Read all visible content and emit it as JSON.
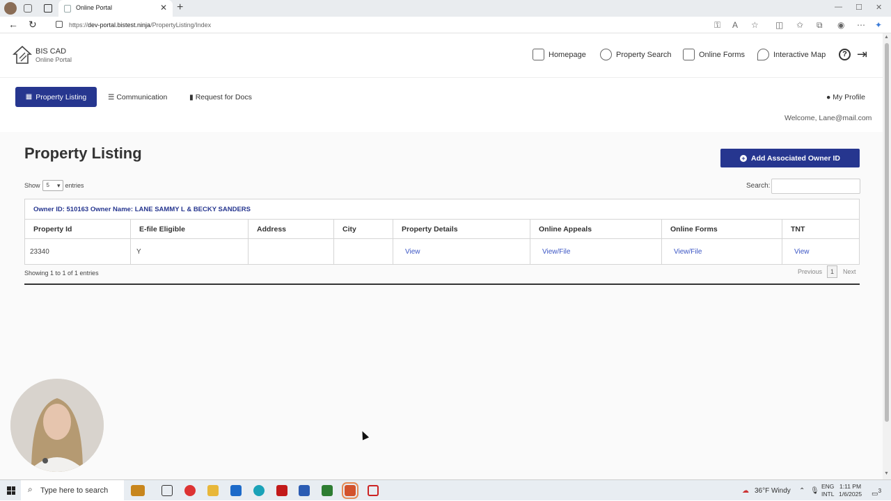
{
  "browser": {
    "tab_title": "Online Portal",
    "url_prefix": "https://",
    "url_domain": "dev-portal.bistest.ninja",
    "url_path": "/PropertyListing/Index"
  },
  "portal": {
    "logo_title": "BIS CAD",
    "logo_subtitle": "Online Portal",
    "top_nav": [
      {
        "label": "Homepage"
      },
      {
        "label": "Property Search"
      },
      {
        "label": "Online Forms"
      },
      {
        "label": "Interactive Map"
      }
    ],
    "sub_nav": {
      "active": "Property Listing",
      "communication": "Communication",
      "request_docs": "Request for Docs",
      "profile": "My Profile",
      "welcome": "Welcome, Lane@mail.com"
    }
  },
  "listing": {
    "title": "Property Listing",
    "add_button": "Add Associated Owner ID",
    "show_label": "Show",
    "entries_value": "5",
    "entries_label": "entries",
    "search_label": "Search:",
    "owner_line": "Owner ID: 510163 Owner Name: LANE SAMMY L & BECKY SANDERS",
    "columns": [
      "Property Id",
      "E-file Eligible",
      "Address",
      "City",
      "Property Details",
      "Online Appeals",
      "Online Forms",
      "TNT"
    ],
    "rows": [
      {
        "property_id": "23340",
        "efile": "Y",
        "address": "",
        "city": "",
        "details": "View",
        "appeals": "View/File",
        "forms": "View/File",
        "tnt": "View"
      }
    ],
    "showing": "Showing 1 to 1 of 1 entries",
    "prev": "Previous",
    "page": "1",
    "next": "Next"
  },
  "taskbar": {
    "search_placeholder": "Type here to search",
    "weather": "36°F  Windy",
    "lang1": "ENG",
    "lang2": "INTL",
    "time": "1:11 PM",
    "date": "1/6/2025",
    "notifications": "3"
  },
  "colors": {
    "primary": "#26368f",
    "link": "#3b55c4"
  }
}
